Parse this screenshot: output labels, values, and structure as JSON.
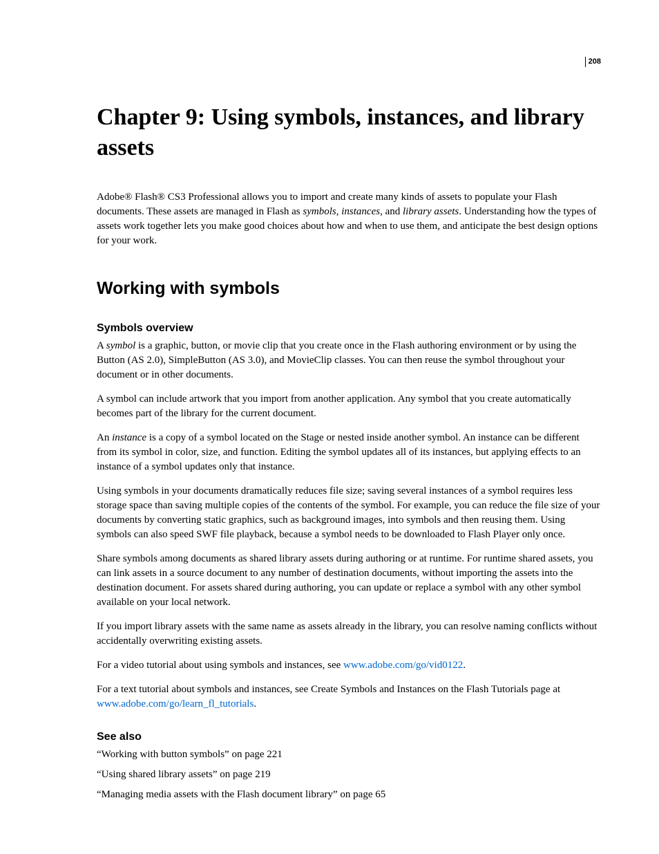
{
  "page_number": "208",
  "chapter_title": "Chapter 9: Using symbols, instances, and library assets",
  "intro": {
    "t1": "Adobe® Flash® CS3 Professional allows you to import and create many kinds of assets to populate your Flash documents. These assets are managed in Flash as ",
    "i1": "symbols",
    "t2": ", ",
    "i2": "instances",
    "t3": ", and ",
    "i3": "library assets",
    "t4": ". Understanding how the types of assets work together lets you make good choices about how and when to use them, and anticipate the best design options for your work."
  },
  "section_title": "Working with symbols",
  "subsection_title": "Symbols overview",
  "p1": {
    "t1": "A ",
    "i1": "symbol",
    "t2": " is a graphic, button, or movie clip that you create once in the Flash authoring environment or by using the Button (AS 2.0), SimpleButton (AS 3.0), and MovieClip classes. You can then reuse the symbol throughout your document or in other documents."
  },
  "p2": "A symbol can include artwork that you import from another application. Any symbol that you create automatically becomes part of the library for the current document.",
  "p3": {
    "t1": "An ",
    "i1": "instance",
    "t2": " is a copy of a symbol located on the Stage or nested inside another symbol. An instance can be different from its symbol in color, size, and function. Editing the symbol updates all of its instances, but applying effects to an instance of a symbol updates only that instance."
  },
  "p4": "Using symbols in your documents dramatically reduces file size; saving several instances of a symbol requires less storage space than saving multiple copies of the contents of the symbol. For example, you can reduce the file size of your documents by converting static graphics, such as background images, into symbols and then reusing them. Using symbols can also speed SWF file playback, because a symbol needs to be downloaded to Flash Player only once.",
  "p5": "Share symbols among documents as shared library assets during authoring or at runtime. For runtime shared assets, you can link assets in a source document to any number of destination documents, without importing the assets into the destination document. For assets shared during authoring, you can update or replace a symbol with any other symbol available on your local network.",
  "p6": "If you import library assets with the same name as assets already in the library, you can resolve naming conflicts without accidentally overwriting existing assets.",
  "p7": {
    "t1": "For a video tutorial about using symbols and instances, see ",
    "link": "www.adobe.com/go/vid0122",
    "t2": "."
  },
  "p8": {
    "t1": "For a text tutorial about symbols and instances, see Create Symbols and Instances on the Flash Tutorials page at ",
    "link": "www.adobe.com/go/learn_fl_tutorials",
    "t2": "."
  },
  "see_also_title": "See also",
  "see_also": [
    "“Working with button symbols” on page 221",
    "“Using shared library assets” on page 219",
    "“Managing media assets with the Flash document library” on page 65"
  ]
}
